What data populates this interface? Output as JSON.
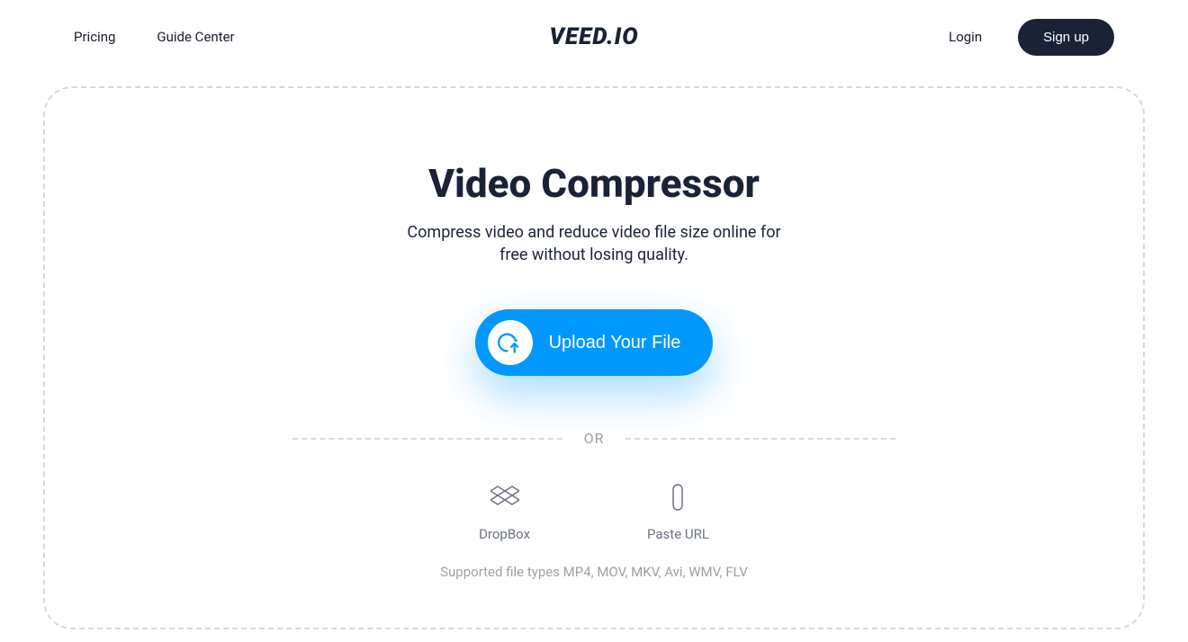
{
  "header": {
    "nav_pricing": "Pricing",
    "nav_guide": "Guide Center",
    "logo": "VEED.IO",
    "login": "Login",
    "signup": "Sign up"
  },
  "main": {
    "title": "Video Compressor",
    "subtitle": "Compress video and reduce video file size online for free without losing quality.",
    "upload_button": "Upload Your File",
    "or_text": "OR",
    "dropbox_label": "DropBox",
    "paste_url_label": "Paste URL",
    "supported_types": "Supported file types MP4, MOV, MKV, Avi, WMV, FLV"
  }
}
